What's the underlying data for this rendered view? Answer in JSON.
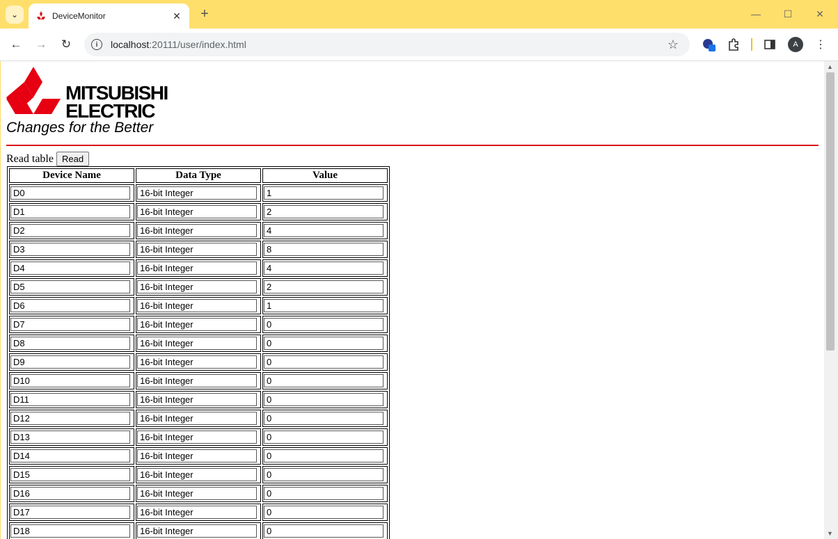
{
  "browser": {
    "tab_title": "DeviceMonitor",
    "url_host": "localhost",
    "url_rest": ":20111/user/index.html",
    "avatar_letter": "A"
  },
  "logo": {
    "line1": "MITSUBISHI",
    "line2": "ELECTRIC",
    "slogan": "Changes for the Better",
    "brand_color": "#d8141b"
  },
  "controls": {
    "read_label": "Read table",
    "read_button": "Read"
  },
  "table": {
    "headers": [
      "Device Name",
      "Data Type",
      "Value"
    ],
    "rows": [
      {
        "name": "D0",
        "type": "16-bit Integer",
        "value": "1"
      },
      {
        "name": "D1",
        "type": "16-bit Integer",
        "value": "2"
      },
      {
        "name": "D2",
        "type": "16-bit Integer",
        "value": "4"
      },
      {
        "name": "D3",
        "type": "16-bit Integer",
        "value": "8"
      },
      {
        "name": "D4",
        "type": "16-bit Integer",
        "value": "4"
      },
      {
        "name": "D5",
        "type": "16-bit Integer",
        "value": "2"
      },
      {
        "name": "D6",
        "type": "16-bit Integer",
        "value": "1"
      },
      {
        "name": "D7",
        "type": "16-bit Integer",
        "value": "0"
      },
      {
        "name": "D8",
        "type": "16-bit Integer",
        "value": "0"
      },
      {
        "name": "D9",
        "type": "16-bit Integer",
        "value": "0"
      },
      {
        "name": "D10",
        "type": "16-bit Integer",
        "value": "0"
      },
      {
        "name": "D11",
        "type": "16-bit Integer",
        "value": "0"
      },
      {
        "name": "D12",
        "type": "16-bit Integer",
        "value": "0"
      },
      {
        "name": "D13",
        "type": "16-bit Integer",
        "value": "0"
      },
      {
        "name": "D14",
        "type": "16-bit Integer",
        "value": "0"
      },
      {
        "name": "D15",
        "type": "16-bit Integer",
        "value": "0"
      },
      {
        "name": "D16",
        "type": "16-bit Integer",
        "value": "0"
      },
      {
        "name": "D17",
        "type": "16-bit Integer",
        "value": "0"
      },
      {
        "name": "D18",
        "type": "16-bit Integer",
        "value": "0"
      }
    ]
  }
}
